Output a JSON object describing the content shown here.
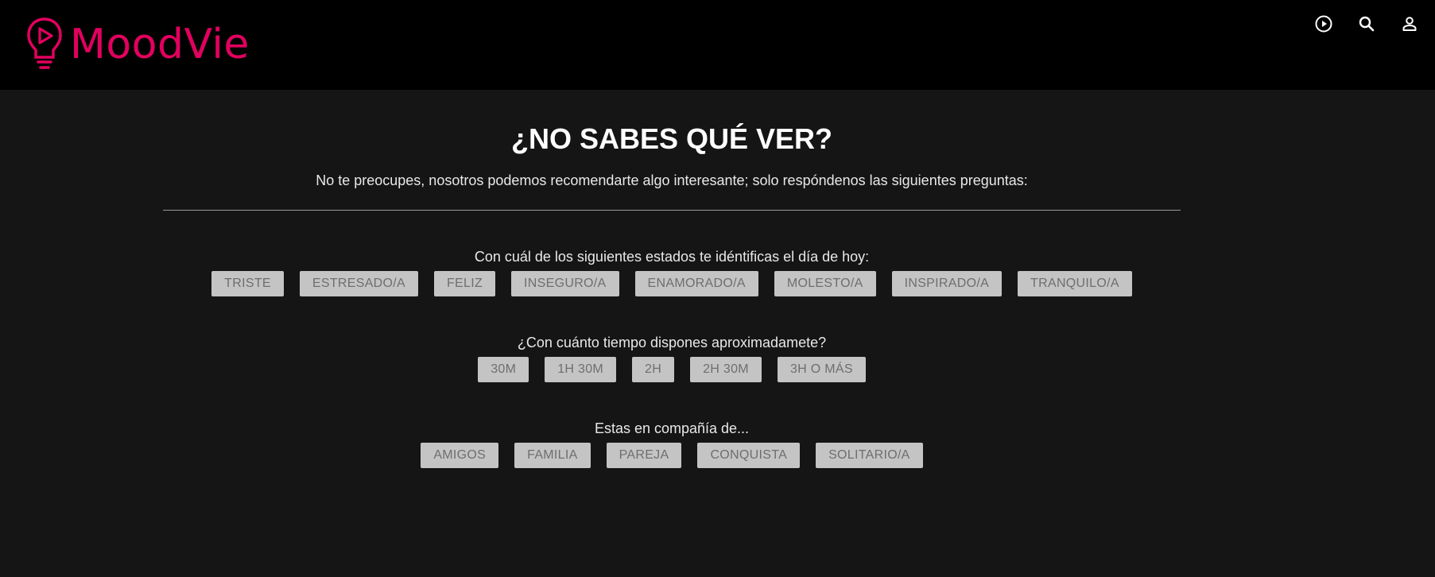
{
  "brand": {
    "name": "MoodVie",
    "accent_color": "#e3005f"
  },
  "topbar": {
    "icons": [
      "play-circle-icon",
      "search-icon",
      "user-icon"
    ]
  },
  "main": {
    "title": "¿NO SABES QUÉ VER?",
    "subtitle": "No te preocupes, nosotros podemos recomendarte algo interesante; solo respóndenos las siguientes preguntas:",
    "questions": [
      {
        "label": "Con cuál de los siguientes estados te idéntificas el día de hoy:",
        "options": [
          "TRISTE",
          "ESTRESADO/A",
          "FELIZ",
          "INSEGURO/A",
          "ENAMORADO/A",
          "MOLESTO/A",
          "INSPIRADO/A",
          "TRANQUILO/A"
        ]
      },
      {
        "label": "¿Con cuánto tiempo dispones aproximadamete?",
        "options": [
          "30M",
          "1H 30M",
          "2H",
          "2H 30M",
          "3H O MÁS"
        ]
      },
      {
        "label": "Estas en compañía de...",
        "options": [
          "AMIGOS",
          "FAMILIA",
          "PAREJA",
          "CONQUISTA",
          "SOLITARIO/A"
        ]
      }
    ]
  }
}
